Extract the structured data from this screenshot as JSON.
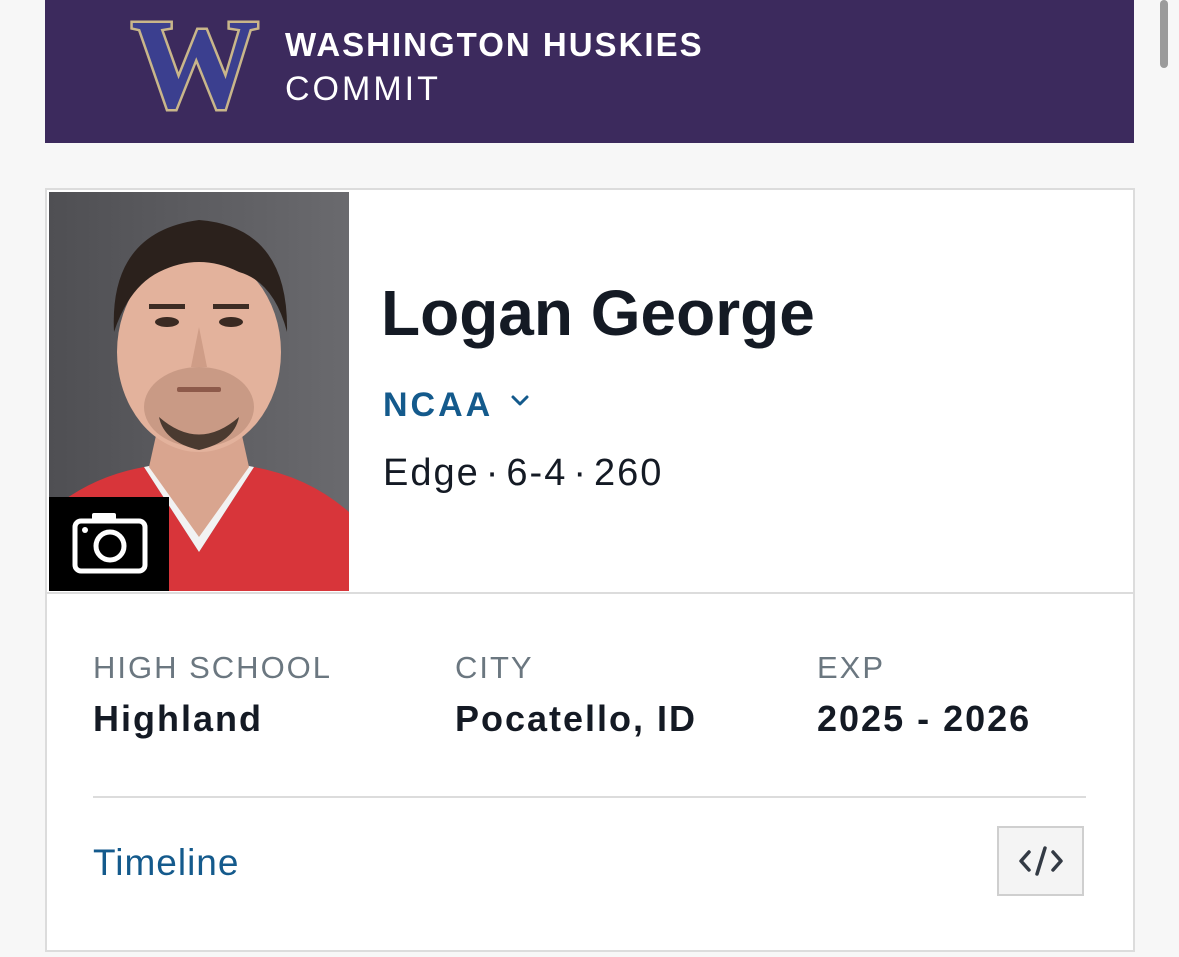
{
  "header": {
    "logo_letter": "W",
    "team_name": "WASHINGTON HUSKIES",
    "status": "COMMIT",
    "colors": {
      "banner": "#3c2a5d",
      "logo_fill": "#3b3f8f",
      "logo_outline": "#c9b68a"
    }
  },
  "player": {
    "name": "Logan George",
    "league": "NCAA",
    "position": "Edge",
    "height": "6-4",
    "weight": "260",
    "separator": "·"
  },
  "details": [
    {
      "label": "HIGH SCHOOL",
      "value": "Highland"
    },
    {
      "label": "CITY",
      "value": "Pocatello, ID"
    },
    {
      "label": "EXP",
      "value": "2025 - 2026"
    }
  ],
  "footer": {
    "timeline_label": "Timeline",
    "embed_icon": "code-icon"
  },
  "colors": {
    "link": "#145a8c",
    "text": "#141a24",
    "muted": "#6b7780",
    "border": "#dcdcdc"
  }
}
